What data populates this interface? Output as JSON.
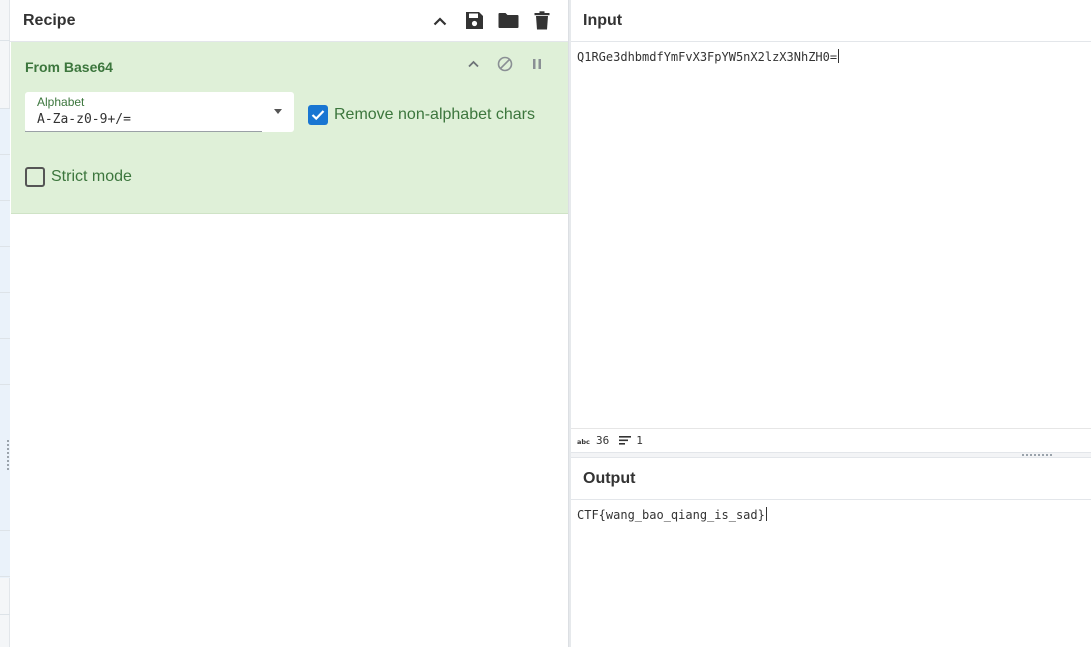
{
  "recipe": {
    "title": "Recipe",
    "icons": [
      "chevron-up-icon",
      "save-icon",
      "folder-icon",
      "trash-icon"
    ],
    "operation": {
      "title": "From Base64",
      "alphabet_label": "Alphabet",
      "alphabet_value": "A-Za-z0-9+/=",
      "remove_non_alphabet_label": "Remove non-alphabet chars",
      "remove_non_alphabet_checked": true,
      "strict_mode_label": "Strict mode",
      "strict_mode_checked": false,
      "colors": {
        "background": "#dff0d8",
        "title": "#3c763d",
        "checkbox": "#1976d2"
      }
    }
  },
  "input": {
    "title": "Input",
    "text": "Q1RGe3dhbmdfYmFvX3FpYW5nX2lzX3NhZH0=",
    "status": {
      "char_count": "36",
      "line_count": "1"
    }
  },
  "output": {
    "title": "Output",
    "text": "CTF{wang_bao_qiang_is_sad}"
  }
}
